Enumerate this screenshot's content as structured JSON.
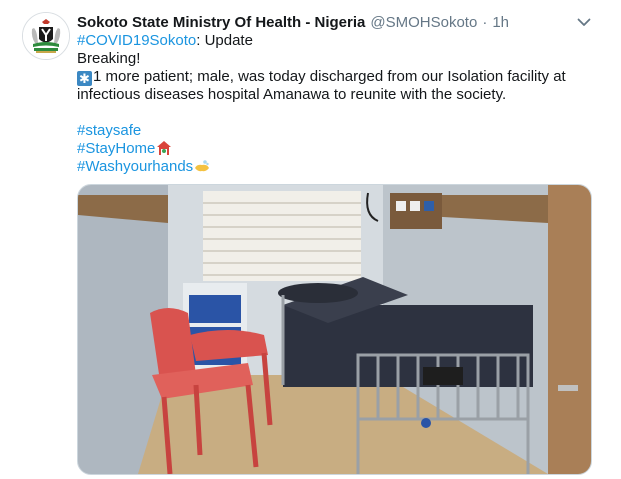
{
  "tweet": {
    "display_name": "Sokoto State Ministry Of Health - Nigeria",
    "handle": "@SMOHSokoto",
    "separator": "·",
    "time": "1h",
    "lines": {
      "hashtag_covid": "#COVID19Sokoto",
      "update_suffix": ": Update",
      "breaking": "Breaking!",
      "body": "1 more patient; male, was today discharged from our Isolation facility at infectious diseases hospital Amanawa to reunite with the society.",
      "tag_staysafe": "#staysafe",
      "tag_stayhome": "#StayHome",
      "tag_wash": "#Washyourhands"
    },
    "asterisk_emoji": "✱"
  },
  "icons": {
    "avatar": "nigeria-coat-of-arms",
    "caret": "chevron-down-icon",
    "house_emoji": "house-with-garden",
    "soap_emoji": "soap-hands"
  },
  "colors": {
    "link": "#1b95e0",
    "secondary_text": "#657786",
    "primary_text": "#14171a"
  },
  "media": {
    "description_alt": ""
  }
}
